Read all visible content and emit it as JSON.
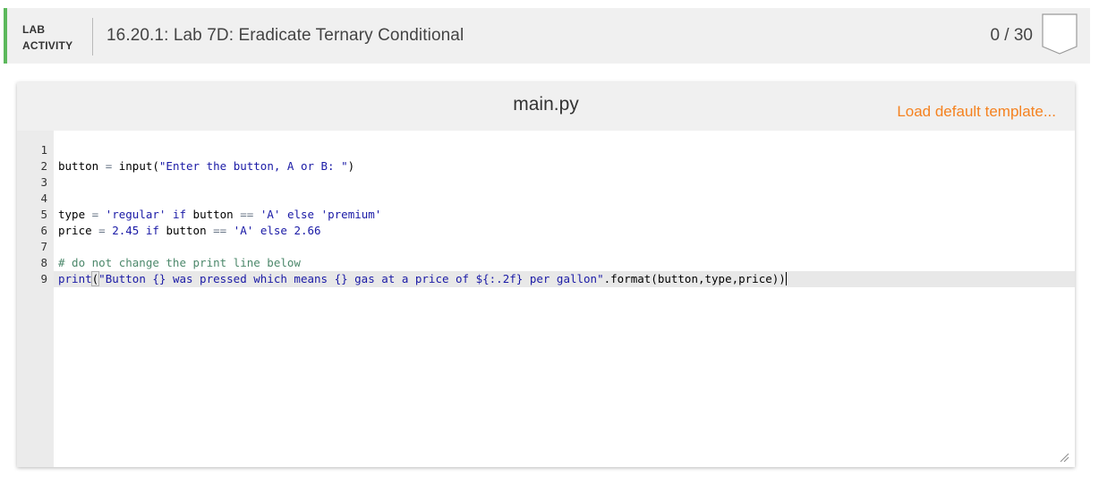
{
  "header": {
    "lab_label_line1": "LAB",
    "lab_label_line2": "ACTIVITY",
    "title": "16.20.1: Lab 7D: Eradicate Ternary Conditional",
    "score": "0 / 30",
    "accent_color": "#5cb85c",
    "badge_icon": "score-shield-icon"
  },
  "editor": {
    "filename": "main.py",
    "load_template_label": "Load default template...",
    "load_template_color": "#f58220",
    "line_numbers": [
      "1",
      "2",
      "3",
      "4",
      "5",
      "6",
      "7",
      "8",
      "9"
    ],
    "lines": [
      {
        "num": "1",
        "code": ""
      },
      {
        "num": "2",
        "code": "button = input(\"Enter the button, A or B: \")"
      },
      {
        "num": "3",
        "code": ""
      },
      {
        "num": "4",
        "code": ""
      },
      {
        "num": "5",
        "code": "type = 'regular' if button == 'A' else 'premium'"
      },
      {
        "num": "6",
        "code": "price = 2.45 if button == 'A' else 2.66"
      },
      {
        "num": "7",
        "code": ""
      },
      {
        "num": "8",
        "code": "# do not change the print line below"
      },
      {
        "num": "9",
        "code": "print(\"Button {} was pressed which means {} gas at a price of ${:.2f} per gallon\".format(button,type,price))"
      }
    ],
    "active_line": "9",
    "resize_icon": "resize-grip-icon"
  }
}
